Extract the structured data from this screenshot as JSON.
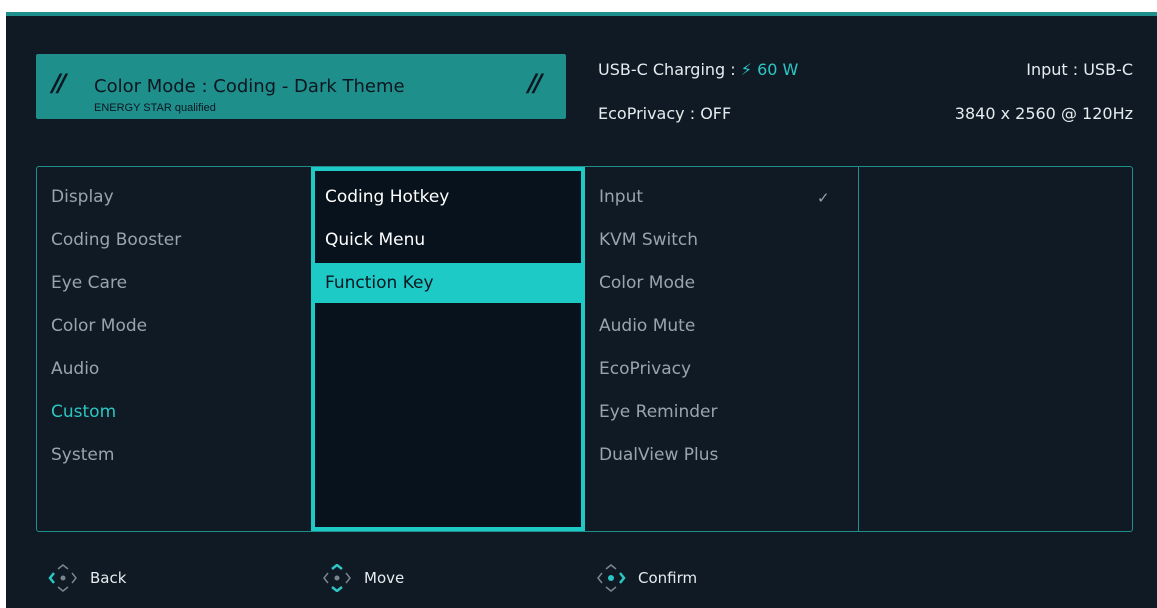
{
  "header": {
    "mode_title": "Color Mode : Coding - Dark Theme",
    "mode_sub": "ENERGY STAR qualified",
    "usb_charging_label": "USB-C Charging : ",
    "usb_charging_value": "60 W",
    "eco_privacy": "EcoPrivacy : OFF",
    "input": "Input : USB-C",
    "resolution": "3840 x 2560 @ 120Hz"
  },
  "menu": {
    "main_items": [
      {
        "label": "Display"
      },
      {
        "label": "Coding Booster"
      },
      {
        "label": "Eye Care"
      },
      {
        "label": "Color Mode"
      },
      {
        "label": "Audio"
      },
      {
        "label": "Custom"
      },
      {
        "label": "System"
      }
    ],
    "sub_items": [
      {
        "label": "Coding Hotkey"
      },
      {
        "label": "Quick Menu"
      },
      {
        "label": "Function Key"
      }
    ],
    "option_items": [
      {
        "label": "Input"
      },
      {
        "label": "KVM Switch"
      },
      {
        "label": "Color Mode"
      },
      {
        "label": "Audio Mute"
      },
      {
        "label": "EcoPrivacy"
      },
      {
        "label": "Eye Reminder"
      },
      {
        "label": "DualView Plus"
      }
    ]
  },
  "footer": {
    "back": "Back",
    "move": "Move",
    "confirm": "Confirm"
  },
  "colors": {
    "accent": "#2cc7c4",
    "banner": "#1f8f8c",
    "background": "#0f1a24"
  }
}
